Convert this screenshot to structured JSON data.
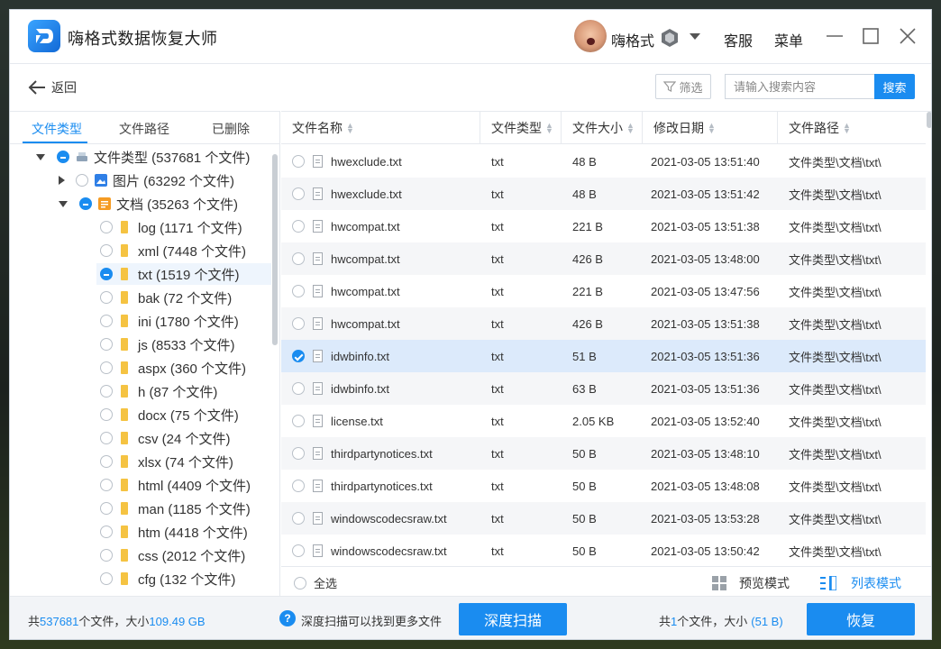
{
  "app": {
    "title": "嗨格式数据恢复大师"
  },
  "user": {
    "name": "嗨格式"
  },
  "header_links": {
    "service": "客服",
    "menu": "菜单"
  },
  "toolbar": {
    "back_label": "返回",
    "filter_label": "筛选",
    "search_placeholder": "请输入搜索内容",
    "search_label": "搜索"
  },
  "tabs": [
    {
      "label": "文件类型",
      "active": true
    },
    {
      "label": "文件路径",
      "active": false
    },
    {
      "label": "已删除",
      "active": false
    }
  ],
  "tree": [
    {
      "label": "文件类型 (537681 个文件)",
      "state": "partial",
      "expanded": true
    },
    {
      "label": "图片 (63292 个文件)",
      "state": "none",
      "expanded": false
    },
    {
      "label": "文档 (35263 个文件)",
      "state": "partial",
      "expanded": true
    },
    {
      "label": "log (1171 个文件)",
      "state": "none"
    },
    {
      "label": "xml (7448 个文件)",
      "state": "none"
    },
    {
      "label": "txt (1519 个文件)",
      "state": "partial",
      "selected": true
    },
    {
      "label": "bak (72 个文件)",
      "state": "none"
    },
    {
      "label": "ini (1780 个文件)",
      "state": "none"
    },
    {
      "label": "js (8533 个文件)",
      "state": "none"
    },
    {
      "label": "aspx (360 个文件)",
      "state": "none"
    },
    {
      "label": "h (87 个文件)",
      "state": "none"
    },
    {
      "label": "docx (75 个文件)",
      "state": "none"
    },
    {
      "label": "csv (24 个文件)",
      "state": "none"
    },
    {
      "label": "xlsx (74 个文件)",
      "state": "none"
    },
    {
      "label": "html (4409 个文件)",
      "state": "none"
    },
    {
      "label": "man (1185 个文件)",
      "state": "none"
    },
    {
      "label": "htm (4418 个文件)",
      "state": "none"
    },
    {
      "label": "css (2012 个文件)",
      "state": "none"
    },
    {
      "label": "cfg (132 个文件)",
      "state": "none"
    }
  ],
  "table": {
    "columns": [
      "文件名称",
      "文件类型",
      "文件大小",
      "修改日期",
      "文件路径"
    ],
    "rows": [
      {
        "name": "hwexclude.txt",
        "type": "txt",
        "size": "48 B",
        "date": "2021-03-05 13:51:40",
        "path": "文件类型\\文档\\txt\\",
        "checked": false
      },
      {
        "name": "hwexclude.txt",
        "type": "txt",
        "size": "48 B",
        "date": "2021-03-05 13:51:42",
        "path": "文件类型\\文档\\txt\\",
        "checked": false
      },
      {
        "name": "hwcompat.txt",
        "type": "txt",
        "size": "221 B",
        "date": "2021-03-05 13:51:38",
        "path": "文件类型\\文档\\txt\\",
        "checked": false
      },
      {
        "name": "hwcompat.txt",
        "type": "txt",
        "size": "426 B",
        "date": "2021-03-05 13:48:00",
        "path": "文件类型\\文档\\txt\\",
        "checked": false
      },
      {
        "name": "hwcompat.txt",
        "type": "txt",
        "size": "221 B",
        "date": "2021-03-05 13:47:56",
        "path": "文件类型\\文档\\txt\\",
        "checked": false
      },
      {
        "name": "hwcompat.txt",
        "type": "txt",
        "size": "426 B",
        "date": "2021-03-05 13:51:38",
        "path": "文件类型\\文档\\txt\\",
        "checked": false
      },
      {
        "name": "idwbinfo.txt",
        "type": "txt",
        "size": "51 B",
        "date": "2021-03-05 13:51:36",
        "path": "文件类型\\文档\\txt\\",
        "checked": true
      },
      {
        "name": "idwbinfo.txt",
        "type": "txt",
        "size": "63 B",
        "date": "2021-03-05 13:51:36",
        "path": "文件类型\\文档\\txt\\",
        "checked": false
      },
      {
        "name": "license.txt",
        "type": "txt",
        "size": "2.05 KB",
        "date": "2021-03-05 13:52:40",
        "path": "文件类型\\文档\\txt\\",
        "checked": false
      },
      {
        "name": "thirdpartynotices.txt",
        "type": "txt",
        "size": "50 B",
        "date": "2021-03-05 13:48:10",
        "path": "文件类型\\文档\\txt\\",
        "checked": false
      },
      {
        "name": "thirdpartynotices.txt",
        "type": "txt",
        "size": "50 B",
        "date": "2021-03-05 13:48:08",
        "path": "文件类型\\文档\\txt\\",
        "checked": false
      },
      {
        "name": "windowscodecsraw.txt",
        "type": "txt",
        "size": "50 B",
        "date": "2021-03-05 13:53:28",
        "path": "文件类型\\文档\\txt\\",
        "checked": false
      },
      {
        "name": "windowscodecsraw.txt",
        "type": "txt",
        "size": "50 B",
        "date": "2021-03-05 13:50:42",
        "path": "文件类型\\文档\\txt\\",
        "checked": false
      }
    ]
  },
  "table_footer": {
    "select_all": "全选",
    "preview_mode": "预览模式",
    "list_mode": "列表模式"
  },
  "status": {
    "total_prefix": "共",
    "total_count": "537681",
    "total_mid": "个文件，大小",
    "total_size": "109.49 GB",
    "deep_hint": "深度扫描可以找到更多文件",
    "deep_scan": "深度扫描",
    "selected_prefix": "共",
    "selected_count": "1",
    "selected_mid": "个文件，大小",
    "selected_size": "(51 B)",
    "recover": "恢复"
  },
  "colors": {
    "accent": "#1a8cf0",
    "selected_row": "#dceafb",
    "alt_row": "#f5f6f8"
  }
}
